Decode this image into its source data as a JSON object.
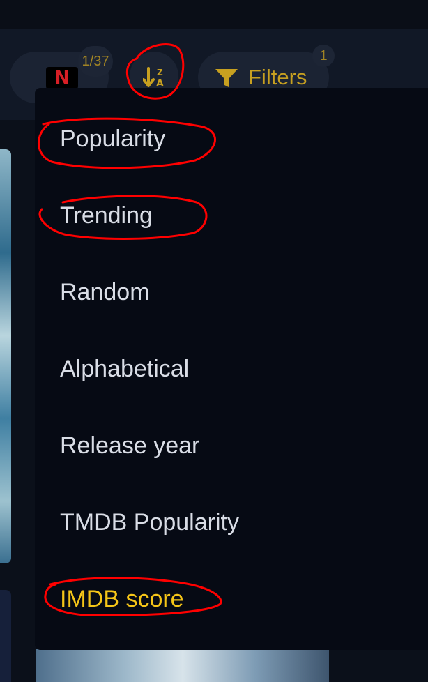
{
  "toolbar": {
    "provider_logo_letter": "N",
    "provider_count": "1/37",
    "sort_icon": "sort-alpha-desc-icon",
    "filters_label": "Filters",
    "filters_badge": "1",
    "accent_color": "#f5c518"
  },
  "sort_menu": {
    "items": [
      {
        "label": "Popularity"
      },
      {
        "label": "Trending"
      },
      {
        "label": "Random"
      },
      {
        "label": "Alphabetical"
      },
      {
        "label": "Release year"
      },
      {
        "label": "TMDB Popularity"
      },
      {
        "label": "IMDB score",
        "selected": true
      }
    ]
  }
}
